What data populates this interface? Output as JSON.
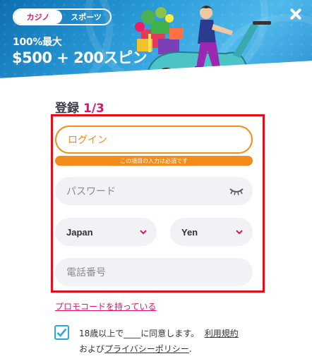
{
  "tabs": [
    {
      "label": "カジノ",
      "active": true
    },
    {
      "label": "スポーツ",
      "active": false
    }
  ],
  "promo": {
    "line1": "100%最大",
    "line2": "$500 + 200スピン"
  },
  "form": {
    "title": "登録",
    "step": "1/3",
    "login_placeholder": "ログイン",
    "login_error": "この項目の入力は必須です",
    "password_placeholder": "パスワード",
    "country_value": "Japan",
    "currency_value": "Yen",
    "phone_placeholder": "電話番号",
    "promo_code_link": "プロモコードを持っている",
    "agreement": {
      "prefix": "18歳以上で",
      "blank": "____",
      "middle": "に同意します。",
      "terms_link": "利用規約",
      "and": "および",
      "privacy_link": "プライバシーポリシー",
      "suffix": ".",
      "checked": true
    }
  },
  "colors": {
    "accent_pink": "#e0136b",
    "error_orange": "#f28c1a",
    "highlight_red": "#e0101b",
    "checkbox_blue": "#2aa8dd",
    "banner_blue": "#2a9bd8"
  },
  "icons": [
    "close-icon",
    "eye-closed-icon",
    "chevron-down-icon",
    "checkmark-icon",
    "scooter-illustration"
  ]
}
